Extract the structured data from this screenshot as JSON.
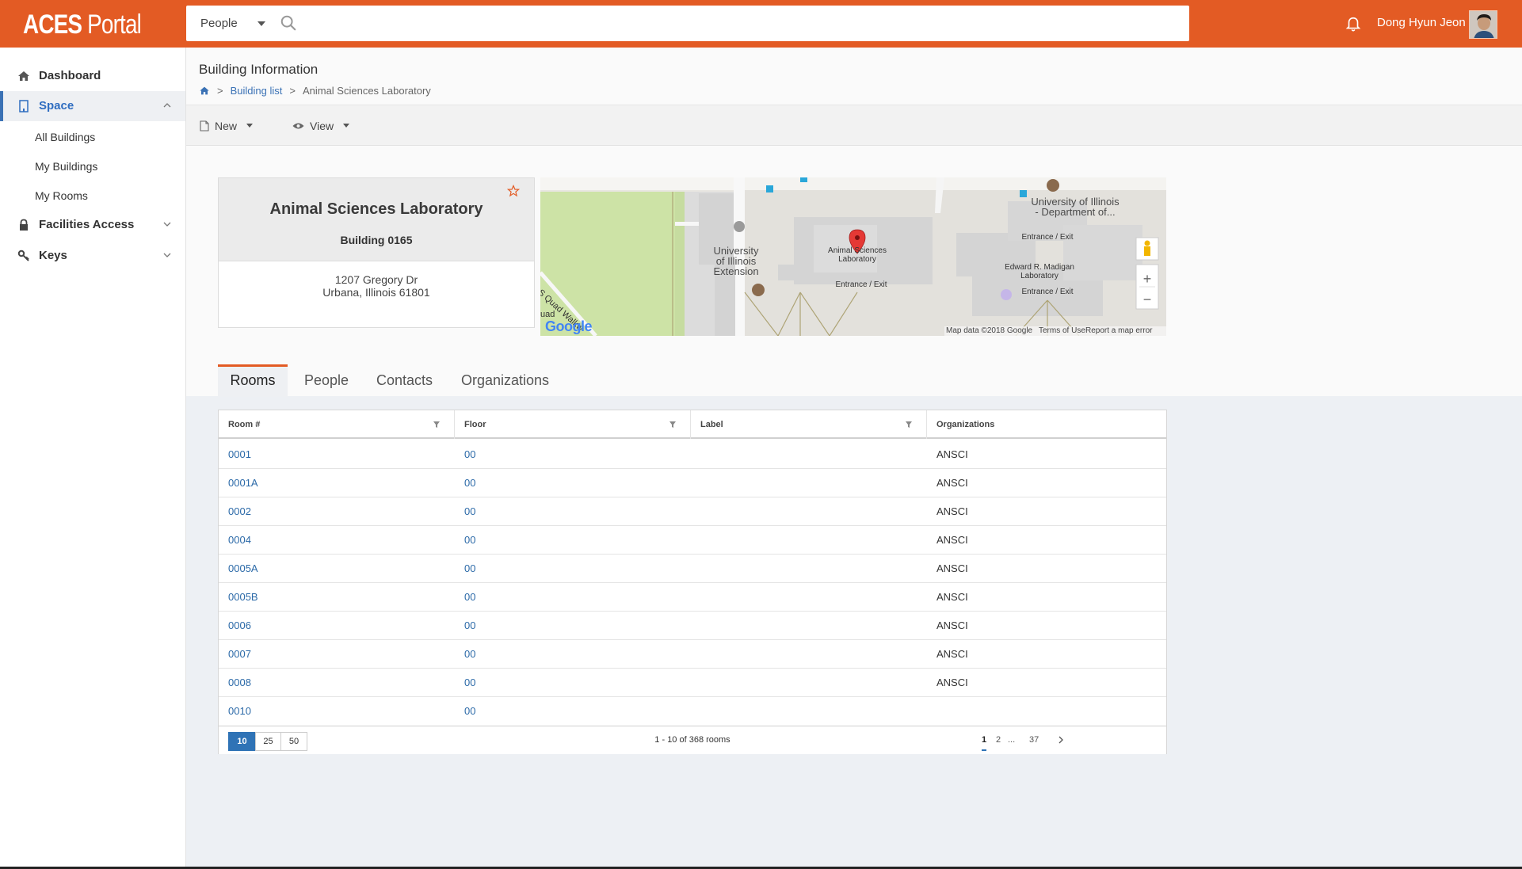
{
  "app": {
    "logo_main": "ACES",
    "logo_sub": "Portal"
  },
  "search": {
    "scope": "People",
    "placeholder": ""
  },
  "user": {
    "name": "Dong Hyun Jeon"
  },
  "sidebar": {
    "items": [
      {
        "label": "Dashboard"
      },
      {
        "label": "Space"
      },
      {
        "label": "Facilities Access"
      },
      {
        "label": "Keys"
      }
    ],
    "space_sub": [
      {
        "label": "All Buildings"
      },
      {
        "label": "My Buildings"
      },
      {
        "label": "My Rooms"
      }
    ]
  },
  "page": {
    "title": "Building Information",
    "breadcrumb": {
      "sep": ">",
      "building_list": "Building list",
      "current": "Animal Sciences Laboratory"
    }
  },
  "toolbar": {
    "new_label": "New",
    "view_label": "View"
  },
  "building": {
    "name": "Animal Sciences Laboratory",
    "number": "Building 0165",
    "address_line1": "1207 Gregory Dr",
    "address_line2": "Urbana, Illinois 61801"
  },
  "map": {
    "labels": {
      "marker": "Animal Sciences\nLaboratory",
      "entrance1": "Entrance / Exit",
      "entrance2": "Entrance / Exit",
      "entrance3": "Entrance / Exit",
      "extension": "University\nof Illinois\nExtension",
      "dept": "University of Illinois\n- Department of...",
      "madigan": "Edward R. Madigan\nLaboratory",
      "quad": "S Quad Walkw",
      "quad2": "uad",
      "google": "Google"
    },
    "footer": {
      "data": "Map data ©2018 Google",
      "terms": "Terms of Use",
      "report": "Report a map error"
    },
    "zoom_in": "+",
    "zoom_out": "−"
  },
  "tabs": [
    {
      "label": "Rooms"
    },
    {
      "label": "People"
    },
    {
      "label": "Contacts"
    },
    {
      "label": "Organizations"
    }
  ],
  "table": {
    "columns": [
      "Room #",
      "Floor",
      "Label",
      "Organizations"
    ],
    "rows": [
      {
        "room": "0001",
        "floor": "00",
        "label": "",
        "org": "ANSCI"
      },
      {
        "room": "0001A",
        "floor": "00",
        "label": "",
        "org": "ANSCI"
      },
      {
        "room": "0002",
        "floor": "00",
        "label": "",
        "org": "ANSCI"
      },
      {
        "room": "0004",
        "floor": "00",
        "label": "",
        "org": "ANSCI"
      },
      {
        "room": "0005A",
        "floor": "00",
        "label": "",
        "org": "ANSCI"
      },
      {
        "room": "0005B",
        "floor": "00",
        "label": "",
        "org": "ANSCI"
      },
      {
        "room": "0006",
        "floor": "00",
        "label": "",
        "org": "ANSCI"
      },
      {
        "room": "0007",
        "floor": "00",
        "label": "",
        "org": "ANSCI"
      },
      {
        "room": "0008",
        "floor": "00",
        "label": "",
        "org": "ANSCI"
      },
      {
        "room": "0010",
        "floor": "00",
        "label": "",
        "org": ""
      }
    ],
    "page_sizes": [
      "10",
      "25",
      "50"
    ],
    "summary": "1 - 10 of 368 rooms",
    "pages": [
      "1",
      "2",
      "...",
      "37"
    ]
  },
  "colors": {
    "brand": "#e35b24",
    "accent": "#2f73b6",
    "link": "#2c6aa8"
  }
}
